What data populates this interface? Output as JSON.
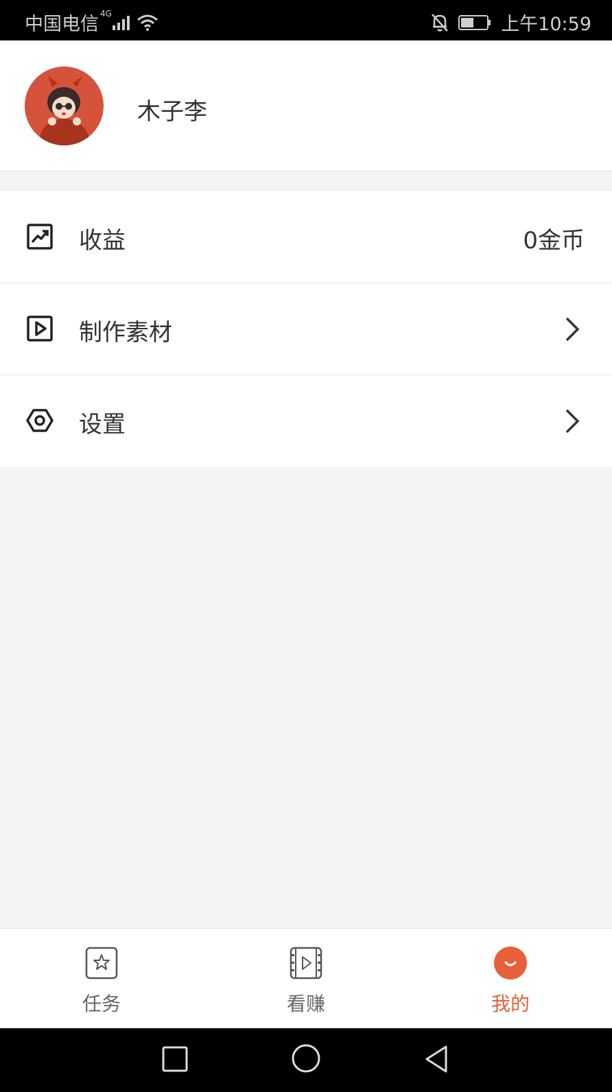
{
  "status_bar": {
    "carrier": "中国电信",
    "network": "4G",
    "time": "上午10:59"
  },
  "profile": {
    "username": "木子李"
  },
  "menu": {
    "items": [
      {
        "label": "收益",
        "value": "0金币",
        "icon": "trend-chart-icon"
      },
      {
        "label": "制作素材",
        "icon": "play-square-icon"
      },
      {
        "label": "设置",
        "icon": "hex-gear-icon"
      }
    ]
  },
  "tabbar": {
    "tabs": [
      {
        "label": "任务",
        "icon": "star-square-icon",
        "active": false
      },
      {
        "label": "看赚",
        "icon": "video-frame-icon",
        "active": false
      },
      {
        "label": "我的",
        "icon": "smile-circle-icon",
        "active": true
      }
    ]
  },
  "colors": {
    "accent": "#e8603a",
    "avatar_bg": "#d5533a"
  }
}
